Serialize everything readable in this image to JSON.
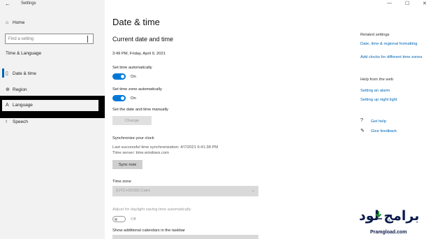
{
  "window": {
    "title": "Settings",
    "back_icon": "←",
    "controls": [
      "—",
      "☐",
      "✕"
    ]
  },
  "sidebar": {
    "home_label": "Home",
    "search_placeholder": "Find a setting",
    "section_label": "Time & Language",
    "items": [
      {
        "label": "Date & time",
        "icon": "calendar-clock-icon",
        "glyph": "▯"
      },
      {
        "label": "Region",
        "icon": "globe-icon",
        "glyph": "⊕"
      },
      {
        "label": "Language",
        "icon": "language-icon",
        "glyph": "A"
      },
      {
        "label": "Speech",
        "icon": "microphone-icon",
        "glyph": "♮"
      }
    ]
  },
  "main": {
    "page_title": "Date & time",
    "section_title": "Current date and time",
    "current_datetime": "3:49 PM, Friday, April 9, 2021",
    "set_time_auto_label": "Set time automatically",
    "set_time_auto_state": "On",
    "set_tz_auto_label": "Set time zone automatically",
    "set_tz_auto_state": "On",
    "set_manual_label": "Set the date and time manually",
    "change_button": "Change",
    "sync_title": "Synchronize your clock",
    "sync_last": "Last successful time synchronization: 4/7/2021 6:41:38 PM",
    "sync_server": "Time server: time.windows.com",
    "sync_button": "Sync now",
    "timezone_label": "Time zone",
    "timezone_value": "(UTC+02:00) Cairo",
    "dst_label": "Adjust for daylight saving time automatically",
    "dst_state": "Off",
    "calendars_label": "Show additional calendars in the taskbar"
  },
  "related": {
    "title": "Related settings",
    "links": [
      "Date, time & regional formatting",
      "Add clocks for different time zones"
    ]
  },
  "help": {
    "title": "Help from the web",
    "links": [
      "Setting an alarm",
      "Setting up night light"
    ]
  },
  "support": {
    "get_help": "Get help",
    "give_feedback": "Give feedback"
  },
  "watermark": {
    "arabic": "برامج لود",
    "latin": "Pramgload.com"
  },
  "colors": {
    "accent": "#0078d7",
    "link": "#0066b4",
    "sidebar_bg": "#f2f2f2"
  }
}
